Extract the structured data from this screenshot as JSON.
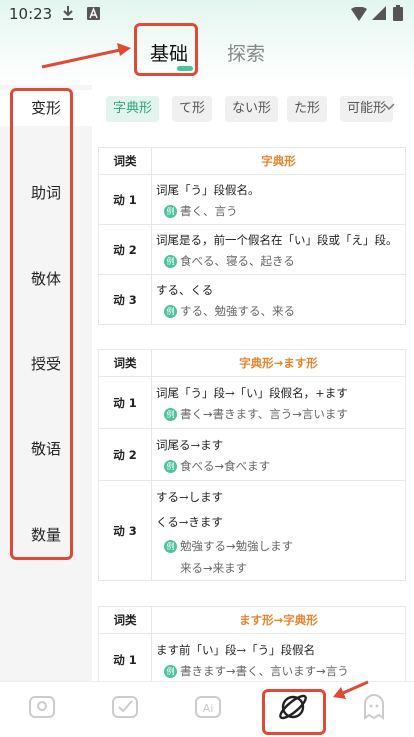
{
  "status": {
    "time": "10:23"
  },
  "header": {
    "tabs": [
      {
        "label": "基础",
        "active": true
      },
      {
        "label": "探索",
        "active": false
      }
    ]
  },
  "sidebar": {
    "items": [
      "变形",
      "助词",
      "敬体",
      "授受",
      "敬语",
      "数量"
    ],
    "active": "变形"
  },
  "chips": [
    "字典形",
    "て形",
    "ない形",
    "た形",
    "可能形"
  ],
  "example_icon_label": "例",
  "tables": [
    {
      "header": [
        "词类",
        "字典形"
      ],
      "rows": [
        {
          "class": "动 1",
          "desc": [
            "词尾「う」段假名。"
          ],
          "example": "書く、言う",
          "extra": []
        },
        {
          "class": "动 2",
          "desc": [
            "词尾是る，前一个假名在「い」段或「え」段。"
          ],
          "example": "食べる、寝る、起きる",
          "extra": []
        },
        {
          "class": "动 3",
          "desc": [
            "する、くる"
          ],
          "example": "する、勉強する、来る",
          "extra": []
        }
      ]
    },
    {
      "header": [
        "词类",
        "字典形→ます形"
      ],
      "rows": [
        {
          "class": "动 1",
          "desc": [
            "词尾「う」段→「い」段假名，+ます"
          ],
          "example": "書く→書きます、言う→言います",
          "extra": []
        },
        {
          "class": "动 2",
          "desc": [
            "词尾る→ます"
          ],
          "example": "食べる→食べます",
          "extra": []
        },
        {
          "class": "动 3",
          "desc": [
            "する→します",
            "くる→きます"
          ],
          "example": "勉強する→勉強します",
          "extra": [
            "来る→来ます"
          ]
        }
      ]
    },
    {
      "header": [
        "词类",
        "ます形→字典形"
      ],
      "rows": [
        {
          "class": "动 1",
          "desc": [
            "ます前「い」段→「う」段假名"
          ],
          "example": "書きます→書く、言います→言う",
          "extra": []
        }
      ]
    }
  ],
  "colors": {
    "accent": "#4cc39a",
    "orange_header": "#e8832e",
    "annotation_red": "#e04a35"
  },
  "bottom_nav": [
    "image-icon",
    "check-icon",
    "ai-icon",
    "planet-icon",
    "ghost-icon"
  ]
}
